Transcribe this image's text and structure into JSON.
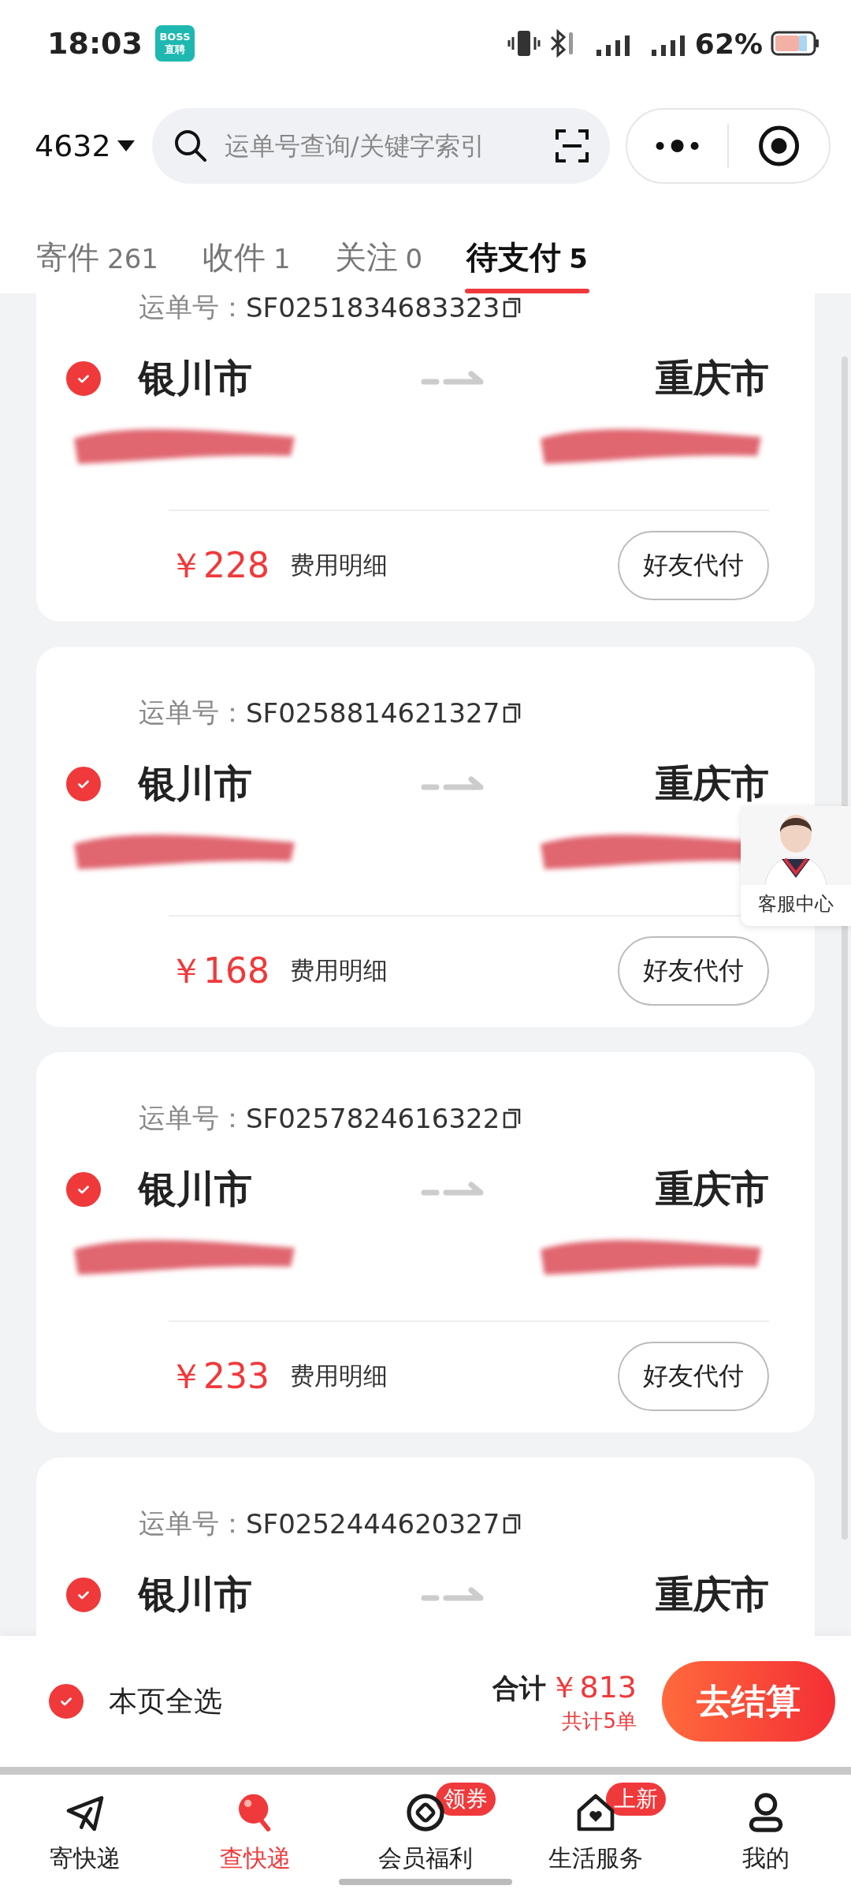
{
  "status_bar": {
    "time": "18:03",
    "app_badge": "BOSS\n直聘",
    "battery": "62%"
  },
  "header": {
    "account": "4632",
    "search": {
      "placeholder": "运单号查询/关键字索引"
    }
  },
  "tabs": [
    {
      "label": "寄件",
      "count": "261",
      "selected": false
    },
    {
      "label": "收件",
      "count": "1",
      "selected": false
    },
    {
      "label": "关注",
      "count": "0",
      "selected": false
    },
    {
      "label": "待支付",
      "count": "5",
      "selected": true
    }
  ],
  "orders": [
    {
      "waybill_label": "运单号：",
      "waybill": "SF0251834683323",
      "from": "银川市",
      "to": "重庆市",
      "checked": true,
      "price": "￥228",
      "detail_link": "费用明细",
      "action": "好友代付"
    },
    {
      "waybill_label": "运单号：",
      "waybill": "SF0258814621327",
      "from": "银川市",
      "to": "重庆市",
      "checked": true,
      "price": "￥168",
      "detail_link": "费用明细",
      "action": "好友代付"
    },
    {
      "waybill_label": "运单号：",
      "waybill": "SF0257824616322",
      "from": "银川市",
      "to": "重庆市",
      "checked": true,
      "price": "￥233",
      "detail_link": "费用明细",
      "action": "好友代付"
    },
    {
      "waybill_label": "运单号：",
      "waybill": "SF0252444620327",
      "from": "银川市",
      "to": "重庆市",
      "checked": true
    }
  ],
  "service_float": {
    "label": "客服中心"
  },
  "checkout": {
    "select_all": {
      "label": "本页全选",
      "checked": true
    },
    "total_label": "合计",
    "total": "￥813",
    "count": "共计5单",
    "button": "去结算"
  },
  "nav": [
    {
      "label": "寄快递",
      "kind": "send",
      "selected": false
    },
    {
      "label": "查快递",
      "kind": "track",
      "selected": true
    },
    {
      "label": "会员福利",
      "kind": "member",
      "selected": false,
      "badge": "领券"
    },
    {
      "label": "生活服务",
      "kind": "life",
      "selected": false,
      "badge": "上新"
    },
    {
      "label": "我的",
      "kind": "me",
      "selected": false
    }
  ]
}
